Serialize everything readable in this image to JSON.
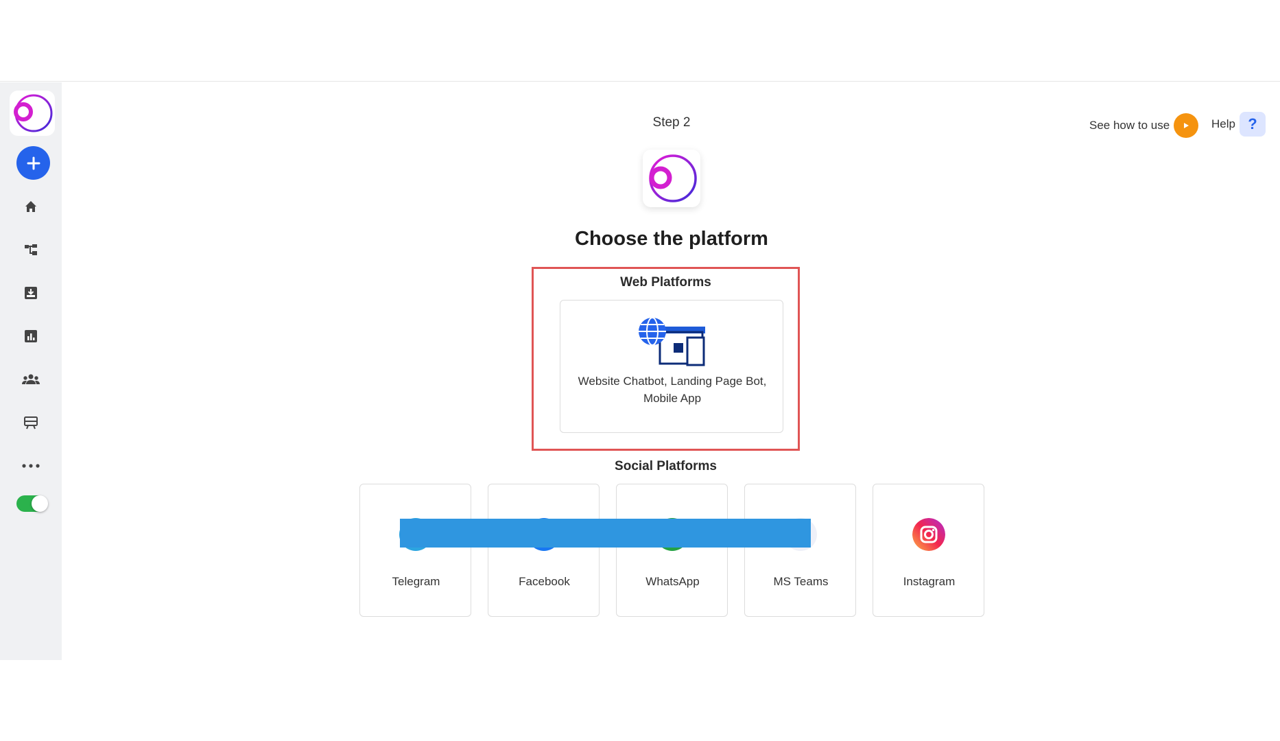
{
  "header": {
    "step_label": "Step 2",
    "see_how_label": "See how to use",
    "help_label": "Help",
    "help_glyph": "?"
  },
  "sidebar": {
    "items": [
      {
        "name": "home-icon"
      },
      {
        "name": "flow-icon"
      },
      {
        "name": "inbox-icon"
      },
      {
        "name": "analytics-icon"
      },
      {
        "name": "audience-icon"
      },
      {
        "name": "templates-icon"
      },
      {
        "name": "more-icon"
      }
    ],
    "toggle_on": true
  },
  "main": {
    "title": "Choose the platform",
    "web_section": {
      "heading": "Web Platforms",
      "card_label": "Website Chatbot, Landing Page Bot, Mobile App"
    },
    "social_section": {
      "heading": "Social Platforms",
      "cards": [
        {
          "label": "Telegram",
          "icon": "telegram-icon"
        },
        {
          "label": "Facebook",
          "icon": "facebook-icon"
        },
        {
          "label": "WhatsApp",
          "icon": "whatsapp-icon"
        },
        {
          "label": "MS Teams",
          "icon": "ms-teams-icon"
        },
        {
          "label": "Instagram",
          "icon": "instagram-icon"
        }
      ]
    }
  },
  "colors": {
    "accent_blue": "#2563eb",
    "highlight_border": "#e05555",
    "toggle_green": "#2bb24c",
    "play_orange": "#f5930f",
    "redaction": "#2f96e0"
  }
}
